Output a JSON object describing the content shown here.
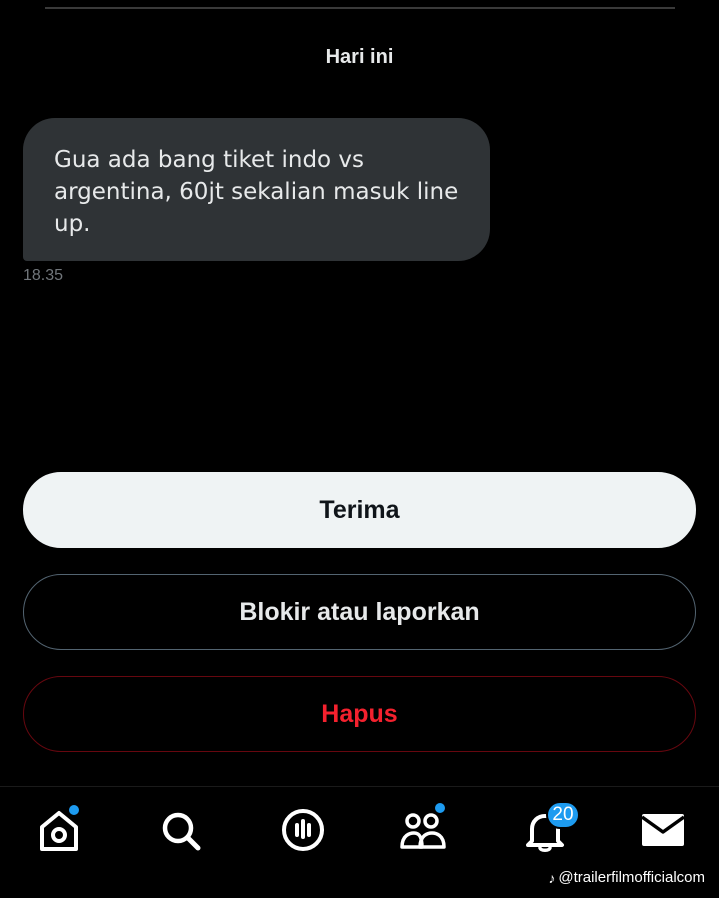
{
  "conversation": {
    "date_label": "Hari ini",
    "message": {
      "text": "Gua ada bang tiket indo vs argentina, 60jt sekalian masuk line up.",
      "time": "18.35"
    }
  },
  "actions": {
    "accept_label": "Terima",
    "block_label": "Blokir atau laporkan",
    "delete_label": "Hapus"
  },
  "nav": {
    "items": [
      {
        "icon": "home-icon",
        "has_dot": true
      },
      {
        "icon": "search-icon",
        "has_dot": false
      },
      {
        "icon": "spaces-icon",
        "has_dot": false
      },
      {
        "icon": "communities-icon",
        "has_dot": true
      },
      {
        "icon": "bell-icon",
        "badge": "20"
      },
      {
        "icon": "mail-icon",
        "has_dot": false
      }
    ]
  },
  "watermark": {
    "handle": "@trailerfilmofficialcom",
    "icon": "tiktok-icon"
  },
  "colors": {
    "background": "#000000",
    "bubble": "#2f3336",
    "accent_blue": "#1d9bf0",
    "danger_red": "#f4212e"
  }
}
